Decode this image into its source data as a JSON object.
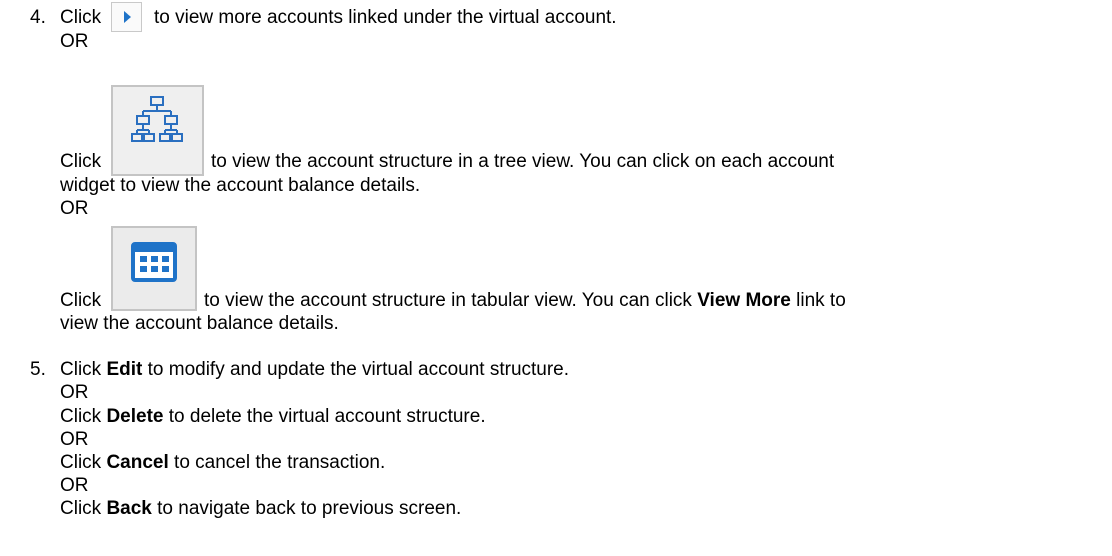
{
  "step4": {
    "number": "4.",
    "line1_click": "Click",
    "line1_rest": "to view more accounts linked under the virtual account.",
    "or1": "OR",
    "line2_click": "Click",
    "line2_rest": "to view the account structure in a tree view. You can click on each account",
    "line2_cont": "widget to view the account balance details.",
    "or2": "OR",
    "line3_click": "Click",
    "line3_rest_a": "to view the account structure in tabular view. You can click",
    "line3_bold": "View More",
    "line3_rest_b": "link to",
    "line3_cont": "view the account balance details."
  },
  "step5": {
    "number": "5.",
    "click": "Click",
    "edit": "Edit",
    "edit_rest": "to modify and update the virtual account structure.",
    "or_a": "OR",
    "delete": "Delete",
    "delete_rest": "to delete the virtual account structure.",
    "or_b": "OR",
    "cancel": "Cancel",
    "cancel_rest": "to cancel the transaction.",
    "or_c": "OR",
    "back": "Back",
    "back_rest": "to navigate back to previous screen."
  },
  "icons": {
    "play": "play-arrow-icon",
    "tree": "tree-structure-icon",
    "grid": "table-grid-icon",
    "accent": "#1f73c8"
  }
}
